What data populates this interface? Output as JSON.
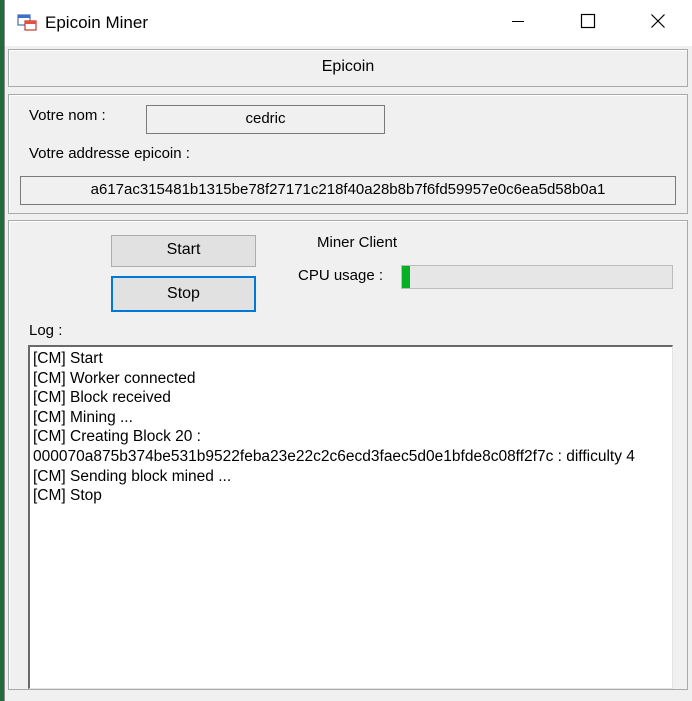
{
  "window": {
    "title": "Epicoin Miner"
  },
  "titlebar": {
    "icons": [
      "app-window-icon",
      "minimize-icon",
      "maximize-icon",
      "close-icon"
    ]
  },
  "header": {
    "label": "Epicoin"
  },
  "identity": {
    "name_label": "Votre nom :",
    "name_value": "cedric",
    "address_label": "Votre addresse epicoin :",
    "address_value": "a617ac315481b1315be78f27171c218f40a28b8b7f6fd59957e0c6ea5d58b0a1"
  },
  "miner": {
    "start_label": "Start",
    "stop_label": "Stop",
    "client_label": "Miner Client",
    "cpu_label": "CPU usage :",
    "cpu_usage_fraction": 0.03,
    "progress_color": "#06b025",
    "focus_color": "#0078d7"
  },
  "log": {
    "label": "Log :",
    "lines": [
      "[CM] Start",
      "[CM] Worker connected",
      "[CM] Block received",
      "[CM] Mining ...",
      "[CM] Creating Block 20 :",
      "000070a875b374be531b9522feba23e22c2c6ecd3faec5d0e1bfde8c08ff2f7c : difficulty 4",
      "[CM] Sending block mined ...",
      "[CM] Stop"
    ]
  }
}
